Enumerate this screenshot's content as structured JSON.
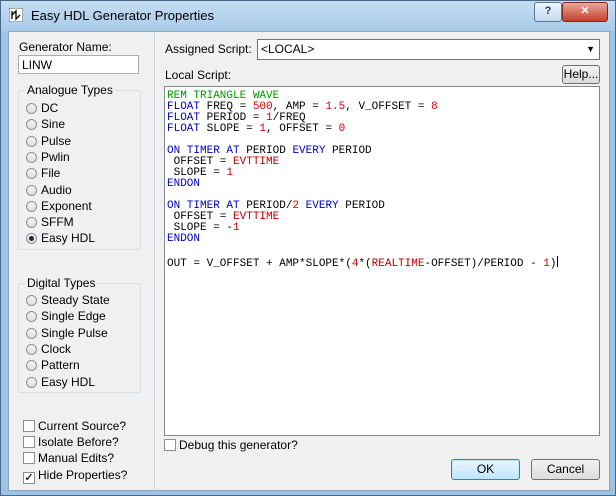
{
  "window": {
    "title": "Easy HDL Generator Properties",
    "help_glyph": "?",
    "close_glyph": "✕"
  },
  "generator": {
    "name_label": "Generator Name:",
    "name_value": "LINW"
  },
  "analogue": {
    "title": "Analogue Types",
    "options": [
      "DC",
      "Sine",
      "Pulse",
      "Pwlin",
      "File",
      "Audio",
      "Exponent",
      "SFFM",
      "Easy HDL"
    ],
    "selected": "Easy HDL"
  },
  "digital": {
    "title": "Digital Types",
    "options": [
      "Steady State",
      "Single Edge",
      "Single Pulse",
      "Clock",
      "Pattern",
      "Easy HDL"
    ],
    "selected": null
  },
  "checkboxes": [
    {
      "label": "Current Source?",
      "checked": false
    },
    {
      "label": "Isolate Before?",
      "checked": false
    },
    {
      "label": "Manual Edits?",
      "checked": false
    },
    {
      "label": "Hide Properties?",
      "checked": true
    }
  ],
  "script": {
    "assigned_label": "Assigned Script:",
    "assigned_value": "<LOCAL>",
    "local_label": "Local Script:",
    "help_button": "Help...",
    "lines": [
      [
        [
          "cm",
          "REM TRIANGLE WAVE"
        ]
      ],
      [
        [
          "kw",
          "FLOAT "
        ],
        [
          "tx",
          "FREQ = "
        ],
        [
          "num",
          "500"
        ],
        [
          "tx",
          ", AMP = "
        ],
        [
          "num",
          "1.5"
        ],
        [
          "tx",
          ", V_OFFSET = "
        ],
        [
          "num",
          "8"
        ]
      ],
      [
        [
          "kw",
          "FLOAT "
        ],
        [
          "tx",
          "PERIOD = "
        ],
        [
          "num",
          "1"
        ],
        [
          "tx",
          "/FREQ"
        ]
      ],
      [
        [
          "kw",
          "FLOAT "
        ],
        [
          "tx",
          "SLOPE = "
        ],
        [
          "num",
          "1"
        ],
        [
          "tx",
          ", OFFSET = "
        ],
        [
          "num",
          "0"
        ]
      ],
      [],
      [
        [
          "kw",
          "ON TIMER AT "
        ],
        [
          "tx",
          "PERIOD "
        ],
        [
          "kw",
          "EVERY "
        ],
        [
          "tx",
          "PERIOD"
        ]
      ],
      [
        [
          "tx",
          " OFFSET = "
        ],
        [
          "fn",
          "EVTTIME"
        ]
      ],
      [
        [
          "tx",
          " SLOPE = "
        ],
        [
          "num",
          "1"
        ]
      ],
      [
        [
          "kw",
          "ENDON"
        ]
      ],
      [],
      [
        [
          "kw",
          "ON TIMER AT "
        ],
        [
          "tx",
          "PERIOD/"
        ],
        [
          "num",
          "2"
        ],
        [
          "tx",
          " "
        ],
        [
          "kw",
          "EVERY "
        ],
        [
          "tx",
          "PERIOD"
        ]
      ],
      [
        [
          "tx",
          " OFFSET = "
        ],
        [
          "fn",
          "EVTTIME"
        ]
      ],
      [
        [
          "tx",
          " SLOPE = -"
        ],
        [
          "num",
          "1"
        ]
      ],
      [
        [
          "kw",
          "ENDON"
        ]
      ],
      [],
      [
        [
          "tx",
          "OUT = V_OFFSET + AMP*SLOPE*("
        ],
        [
          "num",
          "4"
        ],
        [
          "tx",
          "*("
        ],
        [
          "fn",
          "REALTIME"
        ],
        [
          "tx",
          "-OFFSET)/PERIOD - "
        ],
        [
          "num",
          "1"
        ],
        [
          "tx",
          ")"
        ]
      ]
    ]
  },
  "debug": {
    "label": "Debug this generator?",
    "checked": false
  },
  "buttons": {
    "ok": "OK",
    "cancel": "Cancel"
  }
}
